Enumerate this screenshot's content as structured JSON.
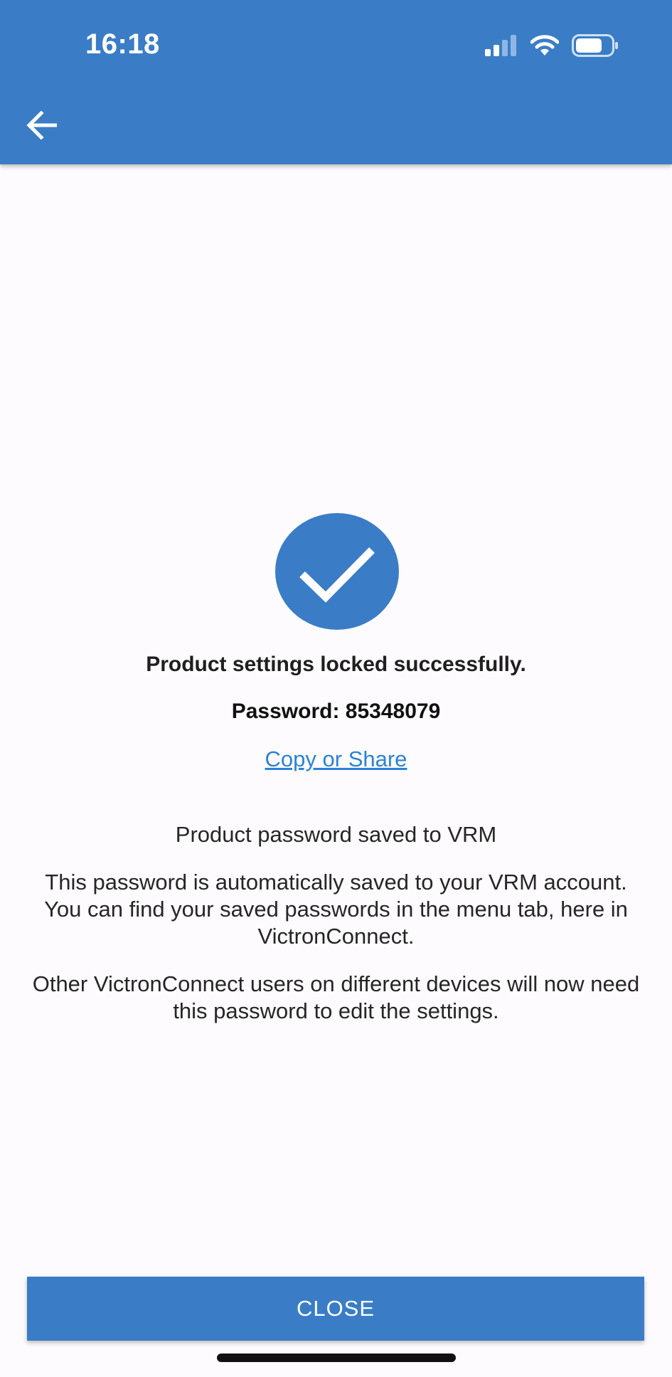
{
  "status_bar": {
    "time": "16:18",
    "icons": [
      "cellular-signal-icon",
      "wifi-icon",
      "battery-icon"
    ]
  },
  "app_bar": {
    "back_icon": "arrow-left-icon",
    "color": "#3a7dc6"
  },
  "main": {
    "success_icon": "check-circle-icon",
    "title": "Product settings locked successfully.",
    "password_line": "Password: 85348079",
    "copy_share_link": "Copy or Share ",
    "saved_heading": "Product password saved to VRM",
    "paragraph_1": "This password is automatically saved to your VRM account. You can find your saved passwords in the menu tab, here in VictronConnect.",
    "paragraph_2": "Other VictronConnect users on different devices will now need this password to edit the settings."
  },
  "footer": {
    "close_label": "CLOSE"
  },
  "colors": {
    "accent": "#3a7dc6",
    "link": "#2b83d6",
    "background": "#fdfbfd"
  }
}
